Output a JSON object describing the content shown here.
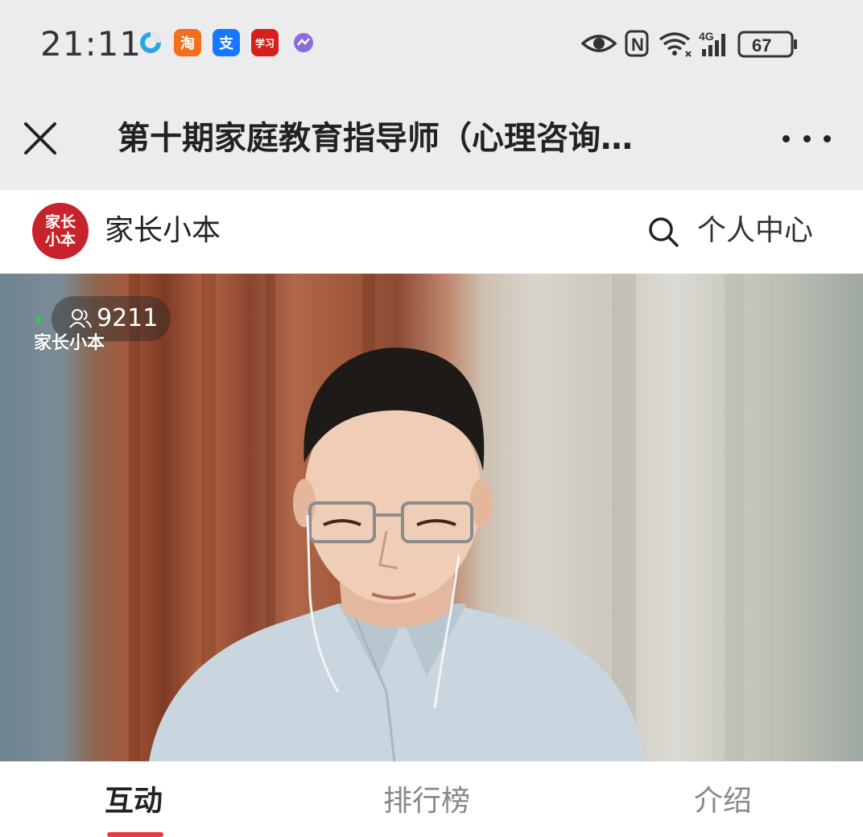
{
  "status_bar": {
    "time": "21:11",
    "battery": "67",
    "network": "4G",
    "notification_icons": [
      "browser-icon",
      "taobao-icon",
      "alipay-icon",
      "xuexi-icon",
      "messenger-icon"
    ],
    "taobao_label": "淘",
    "alipay_label": "支",
    "xuexi_label": "学习",
    "nfc_label": "N"
  },
  "title_bar": {
    "title": "第十期家庭教育指导师（心理咨询…"
  },
  "brand": {
    "logo_line1": "家长",
    "logo_line2": "小本",
    "name": "家长小本",
    "profile_label": "个人中心"
  },
  "video": {
    "viewer_count": "9211",
    "watermark": "家长小本"
  },
  "tabs": [
    {
      "label": "互动",
      "active": true
    },
    {
      "label": "排行榜",
      "active": false
    },
    {
      "label": "介绍",
      "active": false
    }
  ],
  "colors": {
    "accent": "#e8394a",
    "brand_red": "#c8232c",
    "bar_bg": "#ececec"
  }
}
